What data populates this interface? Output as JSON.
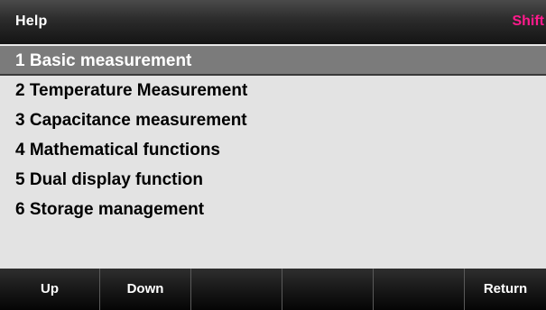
{
  "titlebar": {
    "title": "Help",
    "shift_indicator": "Shift"
  },
  "menu": {
    "selected_index": 0,
    "items": [
      {
        "label": "1 Basic measurement"
      },
      {
        "label": "2 Temperature Measurement"
      },
      {
        "label": "3 Capacitance measurement"
      },
      {
        "label": "4 Mathematical functions"
      },
      {
        "label": "5 Dual display function"
      },
      {
        "label": "6 Storage management"
      }
    ]
  },
  "softkeys": [
    {
      "label": "Up"
    },
    {
      "label": "Down"
    },
    {
      "label": ""
    },
    {
      "label": ""
    },
    {
      "label": ""
    },
    {
      "label": "Return"
    }
  ],
  "colors": {
    "shift_indicator": "#ff1a8c",
    "list_background": "#e3e3e3",
    "selected_row": "#7b7b7b"
  }
}
